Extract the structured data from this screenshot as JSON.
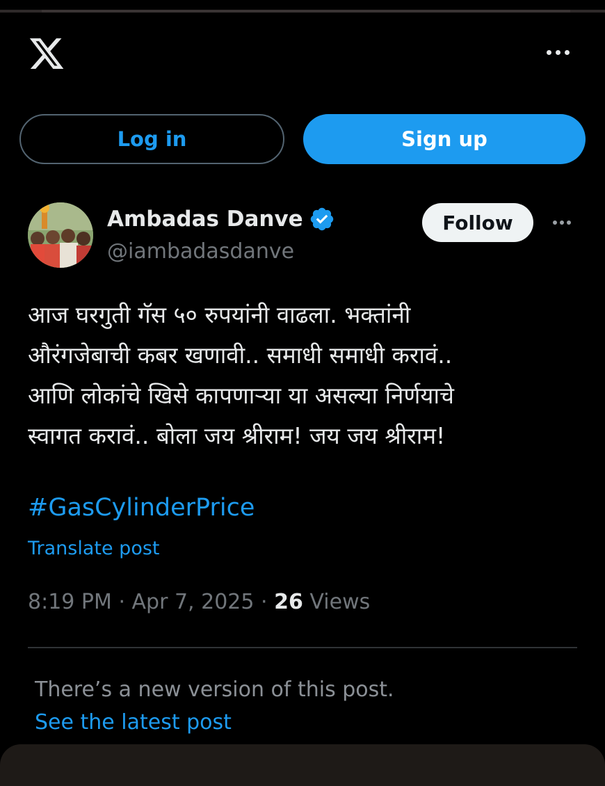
{
  "header": {
    "logo_icon": "x-logo-icon",
    "more_icon": "more-horizontal-icon"
  },
  "auth": {
    "login_label": "Log in",
    "signup_label": "Sign up"
  },
  "tweet": {
    "author": {
      "name": "Ambadas Danve",
      "handle": "@iambadasdanve",
      "verified": true,
      "avatar_icon": "avatar-photo"
    },
    "follow_label": "Follow",
    "text_lines": [
      "आज घरगुती गॅस ५० रुपयांनी वाढला. भक्तांनी",
      "औरंगजेबाची कबर खणावी.. समाधी समाधी करावं..",
      "आणि लोकांचे खिसे कापणाऱ्या या असल्या निर्णयाचे",
      "स्वागत करावं.. बोला जय श्रीराम! जय जय श्रीराम!"
    ],
    "hashtag": "#GasCylinderPrice",
    "translate_label": "Translate post",
    "time": "8:19 PM",
    "date": "Apr 7, 2025",
    "views_count": "26",
    "views_label": "Views",
    "separator": "·"
  },
  "notice": {
    "message": "There’s a new version of this post.",
    "link_label": "See the latest post"
  },
  "colors": {
    "background": "#000000",
    "accent": "#1d9bf0",
    "text_primary": "#e7e9ea",
    "text_secondary": "#71767b",
    "verified": "#1d9bf0"
  }
}
